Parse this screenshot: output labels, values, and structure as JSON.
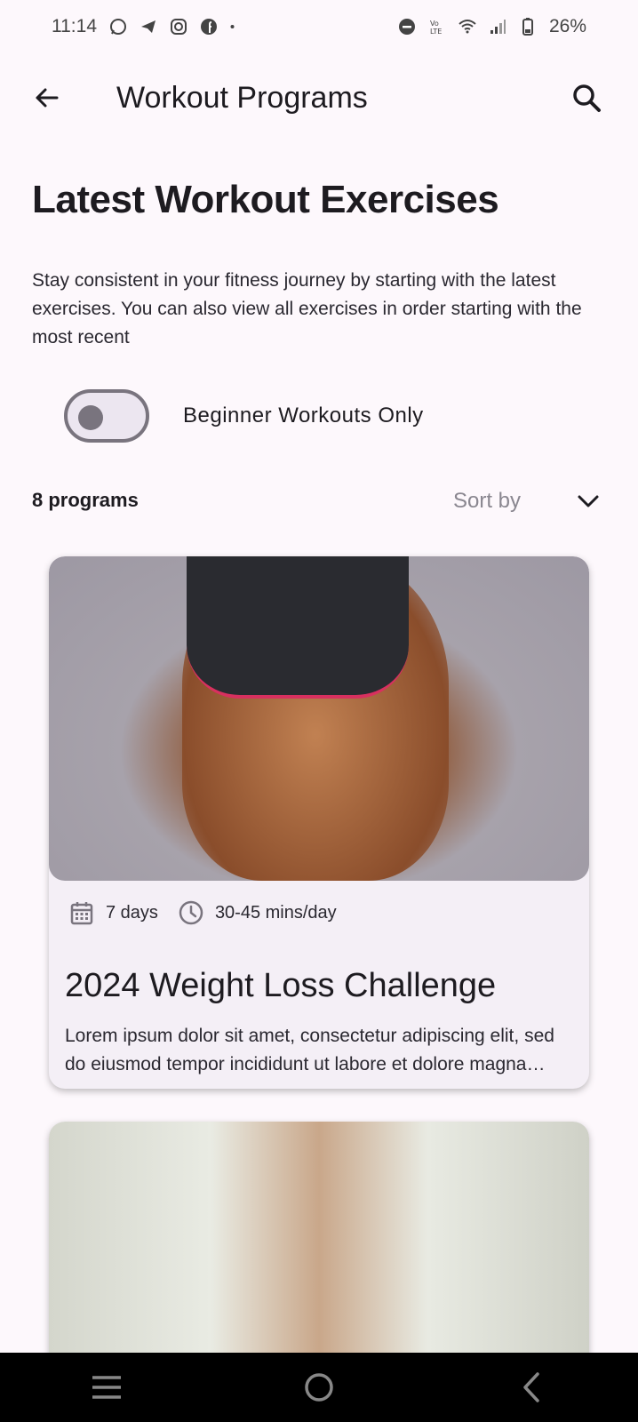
{
  "status_bar": {
    "time": "11:14",
    "battery": "26%",
    "left_icons": [
      "whatsapp-icon",
      "telegram-icon",
      "instagram-icon",
      "facebook-icon",
      "dot-icon"
    ],
    "right_icons": [
      "dnd-icon",
      "volte-icon",
      "wifi-icon",
      "signal-icon",
      "battery-icon"
    ]
  },
  "app_bar": {
    "title": "Workout Programs",
    "back_icon": "arrow-left-icon",
    "search_icon": "search-icon"
  },
  "main": {
    "headline": "Latest Workout Exercises",
    "description": "Stay consistent in your fitness journey by starting with the latest exercises. You can also view all exercises in order starting with the most recent",
    "toggle": {
      "label": "Beginner Workouts Only",
      "checked": false
    },
    "program_count": "8 programs",
    "sort_label": "Sort by"
  },
  "programs": [
    {
      "duration_days": "7 days",
      "time_per_day": "30-45 mins/day",
      "title": "2024 Weight Loss Challenge",
      "description": "Lorem ipsum dolor sit amet, consectetur adipiscing elit, sed do eiusmod tempor incididunt ut labore et dolore magna aliqua."
    }
  ],
  "colors": {
    "background": "#fdf8fc",
    "card": "#f4eff6",
    "toggle_track": "#ece6f0",
    "toggle_outline": "#79747e",
    "nav_bar": "#000000"
  },
  "nav_bar": {
    "icons": [
      "menu-icon",
      "home-icon",
      "back-icon"
    ]
  }
}
